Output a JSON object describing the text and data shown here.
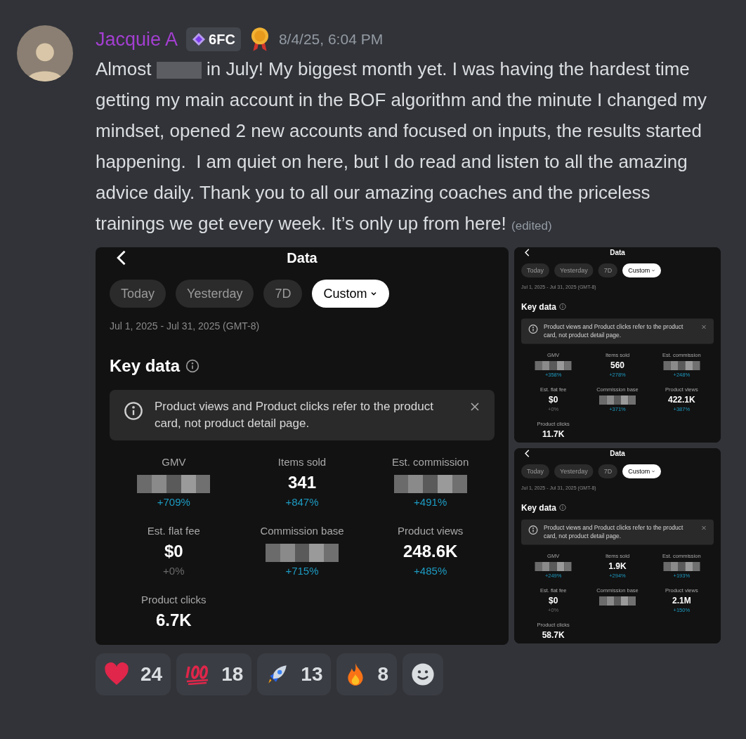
{
  "message": {
    "author": "Jacquie A",
    "tag": "6FC",
    "timestamp": "8/4/25, 6:04 PM",
    "text_before": "Almost",
    "text_after": "in July! My biggest month yet. I was having the hardest time getting my main account in the BOF algorithm and the minute I changed my mindset, opened 2 new accounts and focused on inputs, the results started happening.  I am quiet on here, but I do read and listen to all the amazing advice daily. Thank you to all our amazing coaches and the priceless trainings we get every week. It’s only up from here!",
    "edited": "(edited)"
  },
  "attachments": [
    {
      "kind": "large",
      "title": "Data",
      "tabs": [
        {
          "label": "Today",
          "selected": false,
          "dropdown": false
        },
        {
          "label": "Yesterday",
          "selected": false,
          "dropdown": false
        },
        {
          "label": "7D",
          "selected": false,
          "dropdown": false
        },
        {
          "label": "Custom",
          "selected": true,
          "dropdown": true
        }
      ],
      "date_range": "Jul 1, 2025 - Jul 31, 2025 (GMT-8)",
      "section_title": "Key data",
      "notice": "Product views and Product clicks refer to the product card, not product detail page.",
      "metrics": [
        {
          "label": "GMV",
          "kind": "redacted",
          "delta": {
            "text": "+709%",
            "kind": "up"
          }
        },
        {
          "label": "Items sold",
          "value": "341",
          "kind": "value",
          "delta": {
            "text": "+847%",
            "kind": "up"
          }
        },
        {
          "label": "Est. commission",
          "kind": "redacted",
          "delta": {
            "text": "+491%",
            "kind": "up"
          }
        },
        {
          "label": "Est. flat fee",
          "value": "$0",
          "kind": "value",
          "delta": {
            "text": "+0%",
            "kind": "flat"
          }
        },
        {
          "label": "Commission base",
          "kind": "redacted",
          "delta": {
            "text": "+715%",
            "kind": "up"
          }
        },
        {
          "label": "Product views",
          "value": "248.6K",
          "kind": "value",
          "delta": {
            "text": "+485%",
            "kind": "up"
          }
        },
        {
          "label": "Product clicks",
          "value": "6.7K",
          "kind": "value"
        }
      ]
    },
    {
      "kind": "small",
      "title": "Data",
      "tabs": [
        {
          "label": "Today",
          "selected": false,
          "dropdown": false
        },
        {
          "label": "Yesterday",
          "selected": false,
          "dropdown": false
        },
        {
          "label": "7D",
          "selected": false,
          "dropdown": false
        },
        {
          "label": "Custom",
          "selected": true,
          "dropdown": true
        }
      ],
      "date_range": "Jul 1, 2025 - Jul 31, 2025 (GMT-8)",
      "section_title": "Key data",
      "notice": "Product views and Product clicks refer to the product card, not product detail page.",
      "metrics": [
        {
          "label": "GMV",
          "kind": "redacted",
          "delta": {
            "text": "+358%",
            "kind": "up"
          }
        },
        {
          "label": "Items sold",
          "value": "560",
          "kind": "value",
          "delta": {
            "text": "+278%",
            "kind": "up"
          }
        },
        {
          "label": "Est. commission",
          "kind": "redacted",
          "delta": {
            "text": "+248%",
            "kind": "up"
          }
        },
        {
          "label": "Est. flat fee",
          "value": "$0",
          "kind": "value",
          "delta": {
            "text": "+0%",
            "kind": "flat"
          }
        },
        {
          "label": "Commission base",
          "kind": "redacted",
          "delta": {
            "text": "+371%",
            "kind": "up"
          }
        },
        {
          "label": "Product views",
          "value": "422.1K",
          "kind": "value",
          "delta": {
            "text": "+387%",
            "kind": "up"
          }
        },
        {
          "label": "Product clicks",
          "value": "11.7K",
          "kind": "value"
        }
      ]
    },
    {
      "kind": "small",
      "title": "Data",
      "tabs": [
        {
          "label": "Today",
          "selected": false,
          "dropdown": false
        },
        {
          "label": "Yesterday",
          "selected": false,
          "dropdown": false
        },
        {
          "label": "7D",
          "selected": false,
          "dropdown": false
        },
        {
          "label": "Custom",
          "selected": true,
          "dropdown": true
        }
      ],
      "date_range": "Jul 1, 2025 - Jul 31, 2025 (GMT-8)",
      "section_title": "Key data",
      "notice": "Product views and Product clicks refer to the product card, not product detail page.",
      "metrics": [
        {
          "label": "GMV",
          "kind": "redacted",
          "delta": {
            "text": "+249%",
            "kind": "up"
          }
        },
        {
          "label": "Items sold",
          "value": "1.9K",
          "kind": "value",
          "delta": {
            "text": "+294%",
            "kind": "up"
          }
        },
        {
          "label": "Est. commission",
          "kind": "redacted",
          "delta": {
            "text": "+193%",
            "kind": "up"
          }
        },
        {
          "label": "Est. flat fee",
          "value": "$0",
          "kind": "value",
          "delta": {
            "text": "+0%",
            "kind": "flat"
          }
        },
        {
          "label": "Commission base",
          "kind": "redacted"
        },
        {
          "label": "Product views",
          "value": "2.1M",
          "kind": "value",
          "delta": {
            "text": "+150%",
            "kind": "up"
          }
        },
        {
          "label": "Product clicks",
          "value": "58.7K",
          "kind": "value"
        }
      ]
    }
  ],
  "reactions": [
    {
      "kind": "heart",
      "count": "24"
    },
    {
      "kind": "hundred",
      "count": "18"
    },
    {
      "kind": "rocket",
      "count": "13"
    },
    {
      "kind": "fire",
      "count": "8"
    },
    {
      "kind": "add"
    }
  ]
}
